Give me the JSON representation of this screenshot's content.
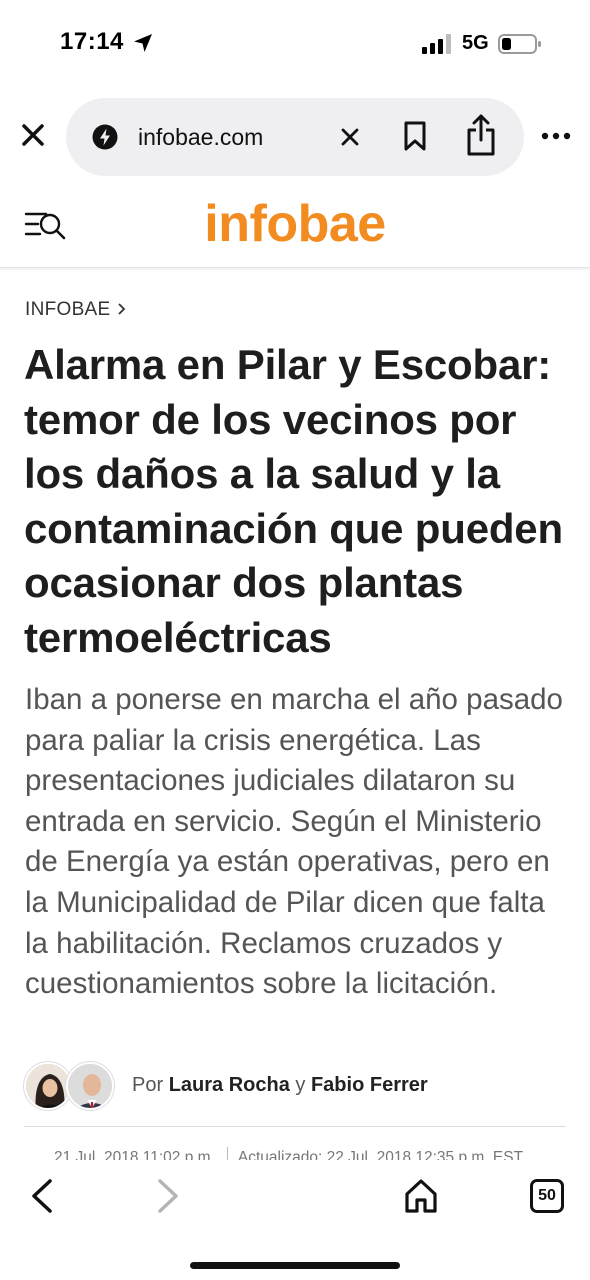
{
  "status_bar": {
    "time": "17:14",
    "network": "5G",
    "icons": [
      "location-arrow-icon",
      "signal-icon",
      "battery-icon"
    ]
  },
  "browser": {
    "url": "infobae.com",
    "icons": [
      "close-icon",
      "site-lightning-icon",
      "clear-url-icon",
      "bookmark-icon",
      "share-icon",
      "more-icon"
    ]
  },
  "site": {
    "logo": "infobae",
    "brand_color": "#f28b20",
    "menu_icon": "menu-search-icon"
  },
  "article": {
    "breadcrumb": "INFOBAE",
    "headline": "Alarma en Pilar y Escobar: temor de los vecinos por los daños a la salud y la contaminación que pueden ocasionar dos plantas termoeléctricas",
    "summary": "Iban a ponerse en marcha el año pasado para paliar la crisis energética. Las presentaciones judiciales dilataron su entrada en servicio. Según el Ministerio de Energía ya están operativas, pero en la Municipalidad de Pilar dicen que falta la habilitación. Reclamos cruzados y cuestionamientos sobre la licitación.",
    "byline_prefix": "Por",
    "author_1": "Laura Rocha",
    "byline_join": "y",
    "author_2": "Fabio Ferrer",
    "published": "21 Jul, 2018 11:02 p.m.",
    "updated": "Actualizado: 22 Jul, 2018 12:35 p.m. EST"
  },
  "toolbar": {
    "tab_count": "50",
    "icons": [
      "back-icon",
      "forward-icon",
      "home-icon",
      "tabs-icon"
    ]
  }
}
